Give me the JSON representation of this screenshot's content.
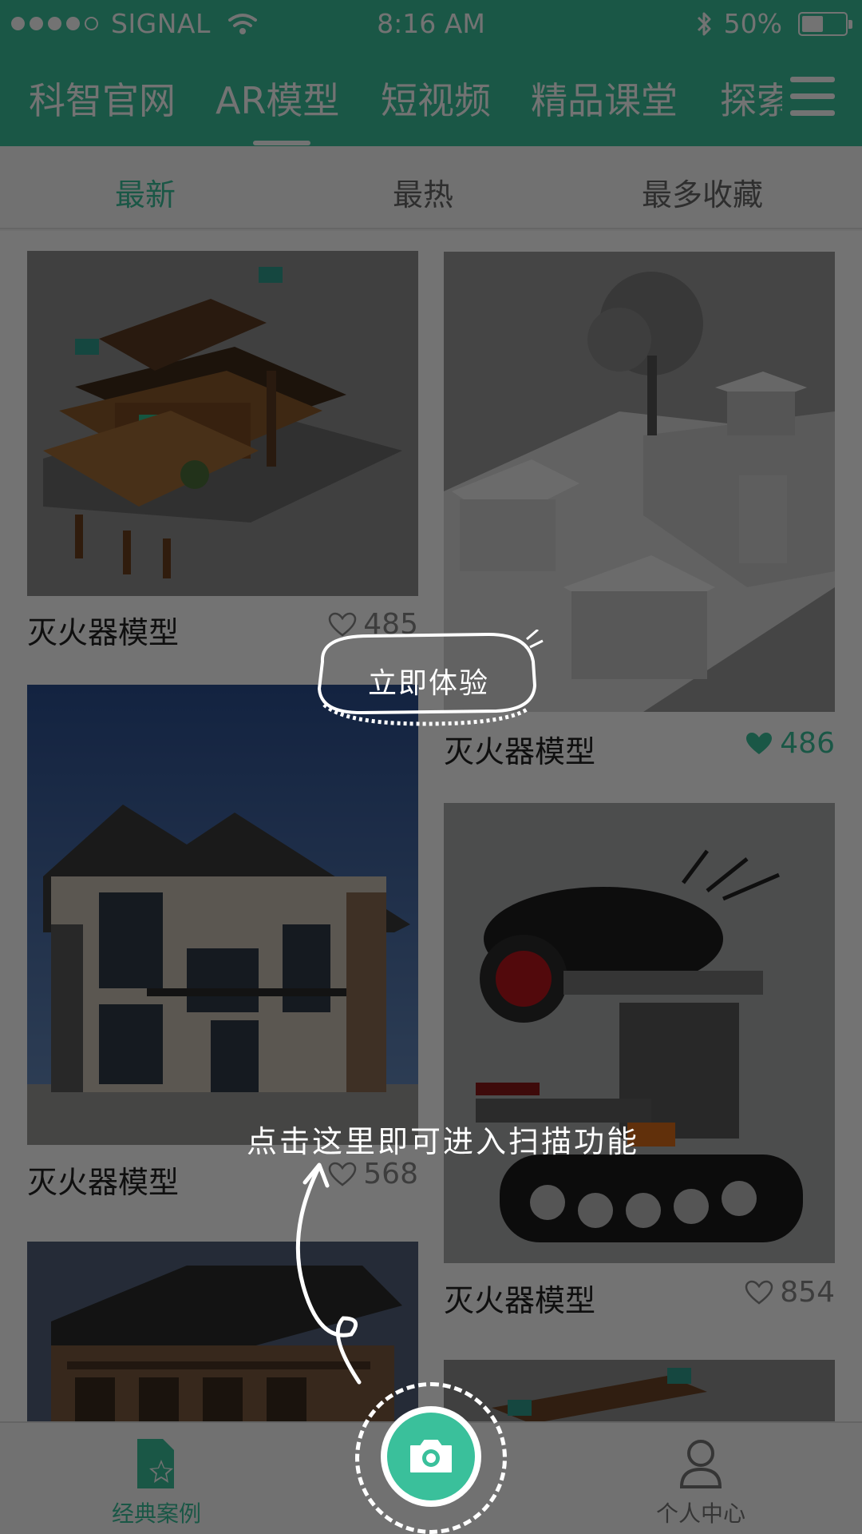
{
  "status_bar": {
    "carrier": "SIGNAL",
    "time": "8:16 AM",
    "battery": "50%",
    "battery_level": 0.5
  },
  "nav": {
    "tabs": [
      "科智官网",
      "AR模型",
      "短视频",
      "精品课堂",
      "探索"
    ],
    "active": "AR模型"
  },
  "sort": {
    "tabs": [
      "最新",
      "最热",
      "最多收藏"
    ],
    "active": "最新"
  },
  "cards": [
    {
      "title": "灭火器模型",
      "likes": "485",
      "liked": false,
      "image": "chinese-wooden-house-model"
    },
    {
      "title": "灭火器模型",
      "likes": "486",
      "liked": true,
      "image": "white-pavilion-diorama-model"
    },
    {
      "title": "灭火器模型",
      "likes": "568",
      "liked": false,
      "image": "modern-villa-model"
    },
    {
      "title": "灭火器模型",
      "likes": "854",
      "liked": false,
      "image": "tracked-robot-model"
    },
    {
      "title": "",
      "likes": "",
      "liked": false,
      "image": "traditional-building-model"
    },
    {
      "title": "",
      "likes": "",
      "liked": false,
      "image": "wooden-house-model-2"
    }
  ],
  "bottom_bar": {
    "left_label": "经典案例",
    "right_label": "个人中心"
  },
  "overlay": {
    "bubble_text": "立即体验",
    "scan_hint": "点击这里即可进入扫描功能"
  },
  "colors": {
    "accent": "#3ac09b",
    "overlay": "rgba(0,0,0,0.55)"
  }
}
